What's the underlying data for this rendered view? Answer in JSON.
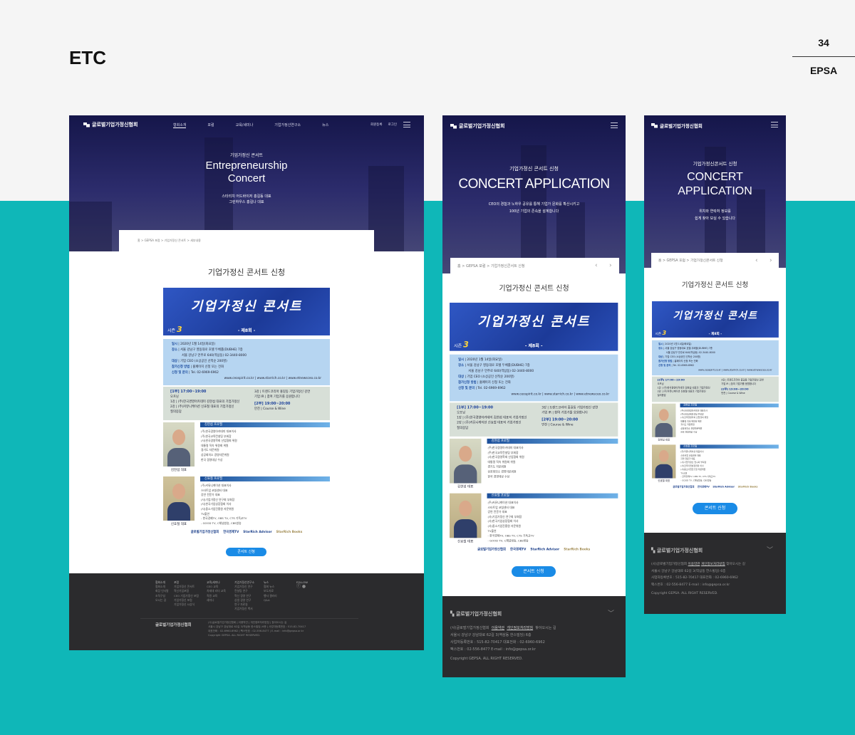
{
  "page": {
    "section": "ETC",
    "page_number": "34",
    "brand": "EPSA"
  },
  "site": {
    "logo": "글로벌기업가정신협회",
    "page_title": "기업가정신 콘서트 신청",
    "apply_button": "콘서트 신청"
  },
  "desktop": {
    "nav": [
      "협회소개",
      "포럼",
      "교육/세미나",
      "기업가정신연구소",
      "뉴스"
    ],
    "util": [
      "회원등록",
      "로그인"
    ],
    "hero": {
      "kicker": "기업가정신 콘서트",
      "title1": "Entrepreneurship",
      "title2": "Concert",
      "sub1": "스타리치 어드바이저 홍길동 대표",
      "sub2": "그린하우스 홍길나 대표"
    },
    "breadcrumb": "홈 > GEPSA 포럼 > 기업가정신 콘서트 > 세부내용",
    "footer": {
      "columns": [
        {
          "title": "협회소개",
          "items": [
            "협회소개",
            "회장 인사말",
            "조직구성",
            "오시는 길"
          ]
        },
        {
          "title": "포럼",
          "items": [
            "기업가정신 콘서트",
            "혁신기업포럼",
            "CEO 기업가정신 포럼",
            "기업가정신 포럼",
            "기업가정신 시상식"
          ]
        },
        {
          "title": "교육/세미나",
          "items": [
            "CEO 교육",
            "차세대 리더 교육",
            "직원 교육",
            "세미나"
          ]
        },
        {
          "title": "기업가정신연구소",
          "items": [
            "기업가정신 연구",
            "컨설팅 연구",
            "혁신 경영 연구",
            "상생 경영 연구",
            "연구 자료실",
            "기업가정신 백서"
          ]
        },
        {
          "title": "뉴스",
          "items": [
            "협회 뉴스",
            "보도자료",
            "행사 갤러리",
            "Q&A"
          ]
        },
        {
          "title": "FOLLOW",
          "items": []
        }
      ],
      "info": [
        "(사)글로벌기업가정신협회 | 이용약관 | 개인정보처리방침 | 찾아오시는 길",
        "서울시 강남구 강남대로 62길 3(역삼동 한스빌딩) 6층 | 사업자등록번호 : 515-82-70417",
        "대표전화 : 02-6960-6962 | 팩스번호 : 02-556-8477 | E-mail : info@gepsa.or.kr",
        "Copyright GEPSA. ALL RIGHT RESERVED."
      ]
    }
  },
  "tablet": {
    "hero": {
      "kicker": "기업가정신 콘서트 신청",
      "title": "CONCERT APPLICATION",
      "sub1": "CEO의 경험과 노하우 공유를 통해 기업가 문화를 확산시키고",
      "sub2": "100년 기업의 존속을 설계합니다"
    },
    "breadcrumb": "홈 > GEPSA 포럼 > 기업가정신콘서트 신청"
  },
  "mobile": {
    "hero": {
      "kicker": "기업가정신콘서트 신청",
      "title1": "CONCERT",
      "title2": "APPLICATION",
      "sub1": "위치와 연락처 정보를",
      "sub2": "쉽게 찾아 보실 수 있습니다"
    },
    "breadcrumb": "홈 > GEPSA 포럼 > 기업가정신콘서트 신청"
  },
  "footer_mobile": {
    "links": [
      "(사)글로벌기업가정신협회",
      "이용약관",
      "개인정보처리방침",
      "찾아오시는 길"
    ],
    "address": "서울시 강남구 강남대로 62길 3(역삼동 한스빌딩) 6층",
    "phone": "사업자등록번호 : 515-82-70417    대표전화 : 02-6960-6962",
    "fax": "팩스번호 : 02-556-8477    E-mail : info@gepsa.or.kr",
    "copyright": "Copyright GEPSA. ALL RIGHT RESERVED."
  },
  "poster": {
    "title": "기업가정신 콘서트",
    "season_label": "시즌",
    "season_num": "3",
    "round": "- 제8회 -",
    "info": [
      {
        "k": "일시",
        "v": "2020년 1월 14일(화요일)"
      },
      {
        "k": "장소",
        "v": "서울 강남구 영동대로 호텔 두베홀(DUBHE) 7층"
      },
      {
        "k": "",
        "v": "서울 강남구 언주로 640(역삼동) 02-3440-8000"
      },
      {
        "k": "대상",
        "v": "기업 CEO (소상공인 선착순 200명)"
      },
      {
        "k": "참가신청 방법",
        "v": "홈페이지 신청 또는 전화"
      },
      {
        "k": "신청 및 문의",
        "v": "Tel. 02-6969-6962"
      }
    ],
    "sites": "www.ceospirit.co.kr | www.starrich.co.kr | www.etnewsceo.co.kr",
    "part1": {
      "time": "[1부] 17:00~19:00",
      "label": "오프닝",
      "items": [
        "1강 | (주)한국경영아카데미 김현섭 대표의 기업가정신",
        "2강 | (주)커뮤니케이션 신효철 대표의 기업가정신",
        "질의응답"
      ]
    },
    "part1b": {
      "item": "3강 | 트렌드코리아 홍길동 기업가정신 강연",
      "ir": "기업 IR | 참여 기업가를 응원합니다"
    },
    "part2": {
      "time": "[2부] 19:00~20:00",
      "label": "만찬 | Course & Wine"
    },
    "speakers": [
      {
        "name": "김현섭 대표",
        "profile": "김현섭 프로필",
        "lines": [
          "(주)한국경영아카데미 대표이사",
          "(주)한국교육컨설팅 부회장",
          "(사)한국경영학회 산업협회 위원",
          "대통령 직속 위원회 위원",
          "경기도 자문위원",
          "상공회의소 경영자문위원",
          "한국 경영대상 수상"
        ]
      },
      {
        "name": "신효철 대표",
        "profile": "신효철 프로필",
        "lines": [
          "(주)커뮤니케이션 대표이사",
          "스타트업 코칭센터 대표",
          "강연 전문가 대표",
          "(사)기업가정신 연구회 부회장",
          "(사)한국기업성장협회 이사",
          "(사)중소기업진흥원 자문위원",
          "TV출연",
          "- 한국경제TV, OBS TV, CTS 기독교TV",
          "- GOOD TV, C채널방송, CBS방송"
        ]
      }
    ],
    "sponsors": [
      "글로벌기업가정신협회",
      "한국경제TV",
      "StarRich Advisor",
      "StarRich Books"
    ]
  },
  "colors": {
    "teal": "#0fb7b8",
    "navy": "#1d1e55",
    "blue": "#1a8be6"
  }
}
